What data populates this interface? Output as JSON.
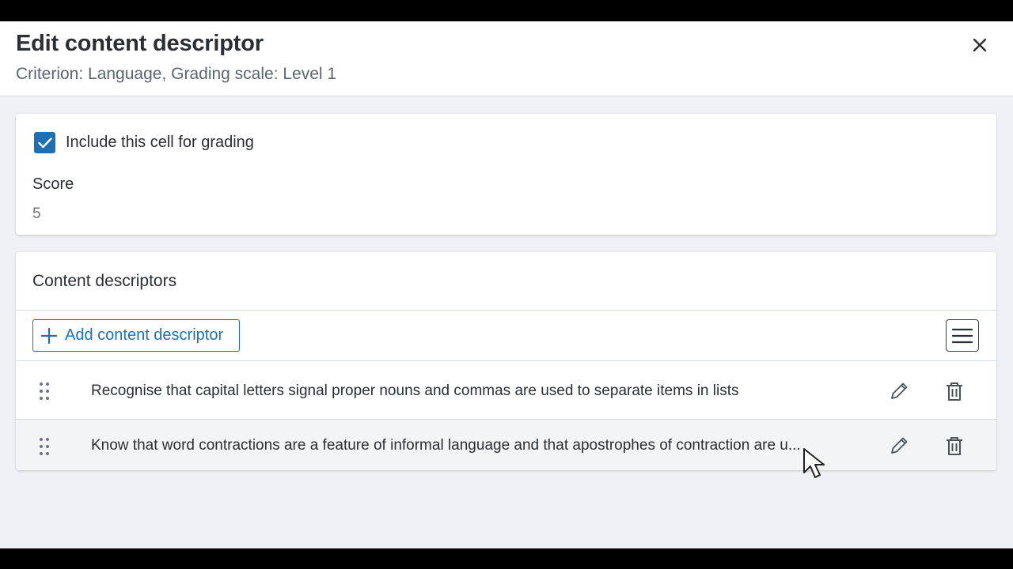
{
  "dialog": {
    "title": "Edit content descriptor",
    "subtitle": "Criterion: Language, Grading scale: Level 1",
    "close_icon": "close-icon"
  },
  "grading": {
    "include_checked": true,
    "include_label": "Include this cell for grading",
    "score_label": "Score",
    "score_value": "5"
  },
  "descriptors": {
    "title": "Content descriptors",
    "add_button_label": "Add content descriptor",
    "items": [
      {
        "text": "Recognise that capital letters signal proper nouns and commas are used to separate items in lists"
      },
      {
        "text": "Know that word contractions are a feature of informal language and that apostrophes of contraction are u..."
      }
    ]
  },
  "colors": {
    "accent": "#1f6fb2",
    "background": "#eef2f6",
    "text": "#2a2f35"
  }
}
